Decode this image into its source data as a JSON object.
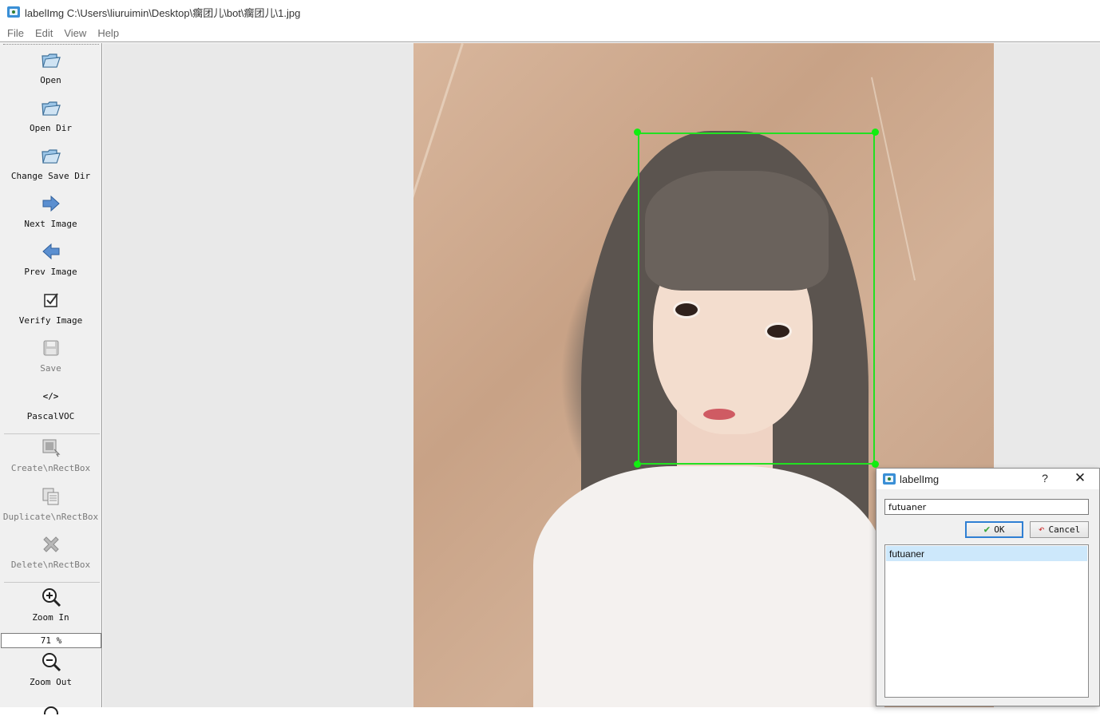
{
  "window": {
    "title": "labelImg C:\\Users\\liuruimin\\Desktop\\瘸团儿\\bot\\瘸团儿\\1.jpg"
  },
  "menu": [
    "File",
    "Edit",
    "View",
    "Help"
  ],
  "toolbar": {
    "open": "Open",
    "open_dir": "Open Dir",
    "change_save_dir": "Change Save Dir",
    "next_image": "Next Image",
    "prev_image": "Prev Image",
    "verify_image": "Verify Image",
    "save": "Save",
    "format_icon_text": "</>",
    "format": "PascalVOC",
    "create_rect": "Create\\nRectBox",
    "duplicate_rect": "Duplicate\\nRectBox",
    "delete_rect": "Delete\\nRectBox",
    "zoom_in": "Zoom In",
    "zoom_level": "71 %",
    "zoom_out": "Zoom Out"
  },
  "dialog": {
    "title": "labelImg",
    "help_symbol": "?",
    "close_symbol": "✕",
    "input_value": "futuaner",
    "ok_label": "OK",
    "cancel_label": "Cancel",
    "label_list": [
      "futuaner"
    ]
  },
  "colors": {
    "bbox": "#22e022",
    "ok_border": "#2f7fd3",
    "list_selection": "#cde8fb"
  },
  "icons": {
    "open": "folder-icon",
    "open_dir": "folder-icon",
    "change_save_dir": "folder-icon",
    "next_image": "arrow-right-icon",
    "prev_image": "arrow-left-icon",
    "verify_image": "checkbox-icon",
    "save": "floppy-icon",
    "format": "code-icon",
    "create_rect": "rect-create-icon",
    "duplicate_rect": "duplicate-icon",
    "delete_rect": "delete-x-icon",
    "zoom_in": "zoom-in-icon",
    "zoom_out": "zoom-out-icon"
  }
}
